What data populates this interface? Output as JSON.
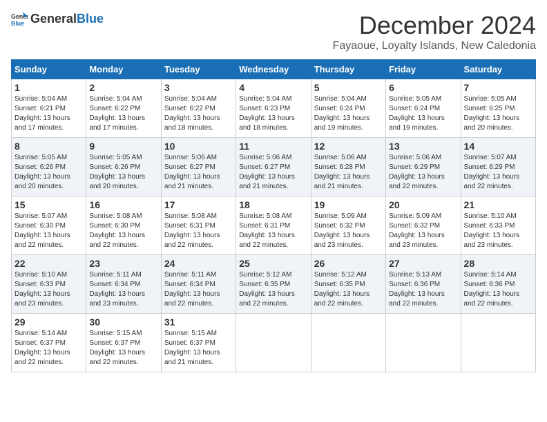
{
  "logo": {
    "general": "General",
    "blue": "Blue"
  },
  "title": "December 2024",
  "location": "Fayaoue, Loyalty Islands, New Caledonia",
  "days_of_week": [
    "Sunday",
    "Monday",
    "Tuesday",
    "Wednesday",
    "Thursday",
    "Friday",
    "Saturday"
  ],
  "weeks": [
    [
      {
        "day": "1",
        "sunrise": "5:04 AM",
        "sunset": "6:21 PM",
        "daylight": "13 hours and 17 minutes."
      },
      {
        "day": "2",
        "sunrise": "5:04 AM",
        "sunset": "6:22 PM",
        "daylight": "13 hours and 17 minutes."
      },
      {
        "day": "3",
        "sunrise": "5:04 AM",
        "sunset": "6:22 PM",
        "daylight": "13 hours and 18 minutes."
      },
      {
        "day": "4",
        "sunrise": "5:04 AM",
        "sunset": "6:23 PM",
        "daylight": "13 hours and 18 minutes."
      },
      {
        "day": "5",
        "sunrise": "5:04 AM",
        "sunset": "6:24 PM",
        "daylight": "13 hours and 19 minutes."
      },
      {
        "day": "6",
        "sunrise": "5:05 AM",
        "sunset": "6:24 PM",
        "daylight": "13 hours and 19 minutes."
      },
      {
        "day": "7",
        "sunrise": "5:05 AM",
        "sunset": "6:25 PM",
        "daylight": "13 hours and 20 minutes."
      }
    ],
    [
      {
        "day": "8",
        "sunrise": "5:05 AM",
        "sunset": "6:26 PM",
        "daylight": "13 hours and 20 minutes."
      },
      {
        "day": "9",
        "sunrise": "5:05 AM",
        "sunset": "6:26 PM",
        "daylight": "13 hours and 20 minutes."
      },
      {
        "day": "10",
        "sunrise": "5:06 AM",
        "sunset": "6:27 PM",
        "daylight": "13 hours and 21 minutes."
      },
      {
        "day": "11",
        "sunrise": "5:06 AM",
        "sunset": "6:27 PM",
        "daylight": "13 hours and 21 minutes."
      },
      {
        "day": "12",
        "sunrise": "5:06 AM",
        "sunset": "6:28 PM",
        "daylight": "13 hours and 21 minutes."
      },
      {
        "day": "13",
        "sunrise": "5:06 AM",
        "sunset": "6:29 PM",
        "daylight": "13 hours and 22 minutes."
      },
      {
        "day": "14",
        "sunrise": "5:07 AM",
        "sunset": "6:29 PM",
        "daylight": "13 hours and 22 minutes."
      }
    ],
    [
      {
        "day": "15",
        "sunrise": "5:07 AM",
        "sunset": "6:30 PM",
        "daylight": "13 hours and 22 minutes."
      },
      {
        "day": "16",
        "sunrise": "5:08 AM",
        "sunset": "6:30 PM",
        "daylight": "13 hours and 22 minutes."
      },
      {
        "day": "17",
        "sunrise": "5:08 AM",
        "sunset": "6:31 PM",
        "daylight": "13 hours and 22 minutes."
      },
      {
        "day": "18",
        "sunrise": "5:08 AM",
        "sunset": "6:31 PM",
        "daylight": "13 hours and 22 minutes."
      },
      {
        "day": "19",
        "sunrise": "5:09 AM",
        "sunset": "6:32 PM",
        "daylight": "13 hours and 23 minutes."
      },
      {
        "day": "20",
        "sunrise": "5:09 AM",
        "sunset": "6:32 PM",
        "daylight": "13 hours and 23 minutes."
      },
      {
        "day": "21",
        "sunrise": "5:10 AM",
        "sunset": "6:33 PM",
        "daylight": "13 hours and 23 minutes."
      }
    ],
    [
      {
        "day": "22",
        "sunrise": "5:10 AM",
        "sunset": "6:33 PM",
        "daylight": "13 hours and 23 minutes."
      },
      {
        "day": "23",
        "sunrise": "5:11 AM",
        "sunset": "6:34 PM",
        "daylight": "13 hours and 23 minutes."
      },
      {
        "day": "24",
        "sunrise": "5:11 AM",
        "sunset": "6:34 PM",
        "daylight": "13 hours and 22 minutes."
      },
      {
        "day": "25",
        "sunrise": "5:12 AM",
        "sunset": "6:35 PM",
        "daylight": "13 hours and 22 minutes."
      },
      {
        "day": "26",
        "sunrise": "5:12 AM",
        "sunset": "6:35 PM",
        "daylight": "13 hours and 22 minutes."
      },
      {
        "day": "27",
        "sunrise": "5:13 AM",
        "sunset": "6:36 PM",
        "daylight": "13 hours and 22 minutes."
      },
      {
        "day": "28",
        "sunrise": "5:14 AM",
        "sunset": "6:36 PM",
        "daylight": "13 hours and 22 minutes."
      }
    ],
    [
      {
        "day": "29",
        "sunrise": "5:14 AM",
        "sunset": "6:37 PM",
        "daylight": "13 hours and 22 minutes."
      },
      {
        "day": "30",
        "sunrise": "5:15 AM",
        "sunset": "6:37 PM",
        "daylight": "13 hours and 22 minutes."
      },
      {
        "day": "31",
        "sunrise": "5:15 AM",
        "sunset": "6:37 PM",
        "daylight": "13 hours and 21 minutes."
      },
      null,
      null,
      null,
      null
    ]
  ]
}
